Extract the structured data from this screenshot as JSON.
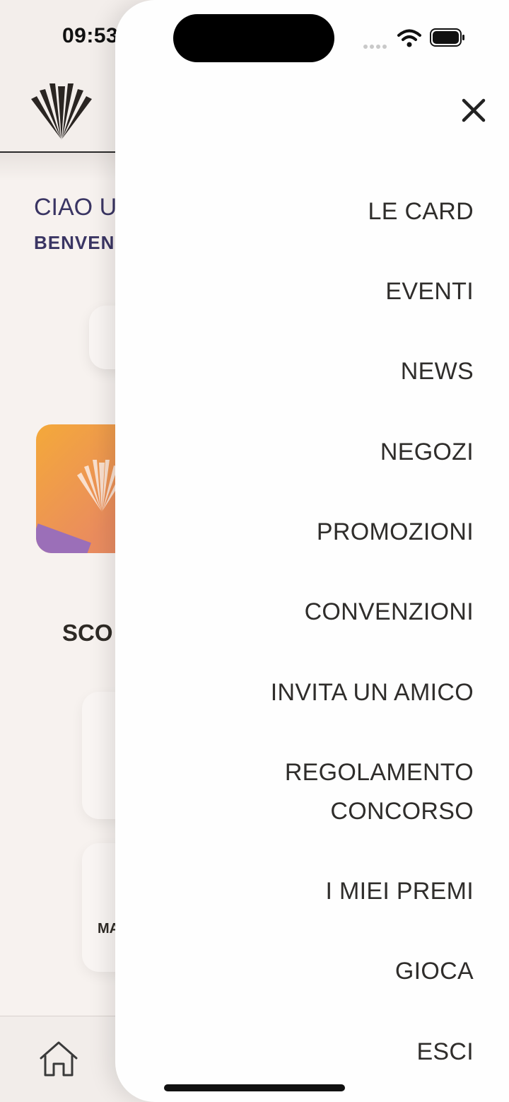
{
  "status_bar": {
    "time": "09:53"
  },
  "background": {
    "greeting": "CIAO U",
    "welcome": "BENVEN",
    "section_title": "SCO",
    "tile_label": "MA"
  },
  "menu": {
    "items": [
      {
        "label": "LE CARD"
      },
      {
        "label": "EVENTI"
      },
      {
        "label": "NEWS"
      },
      {
        "label": "NEGOZI"
      },
      {
        "label": "PROMOZIONI"
      },
      {
        "label": "CONVENZIONI"
      },
      {
        "label": "INVITA UN AMICO"
      },
      {
        "label": "REGOLAMENTO",
        "label2": "CONCORSO"
      },
      {
        "label": "I MIEI PREMI"
      },
      {
        "label": "GIOCA"
      },
      {
        "label": "ESCI"
      }
    ]
  },
  "icons": {
    "close": "close-icon",
    "home": "home-icon",
    "logo": "brand-logo-icon",
    "wifi": "wifi-icon",
    "battery": "battery-icon"
  },
  "colors": {
    "accent_text": "#3a3563",
    "menu_text": "#2f2d2b",
    "promo_start": "#f4a93a",
    "promo_end": "#e38a6e"
  }
}
